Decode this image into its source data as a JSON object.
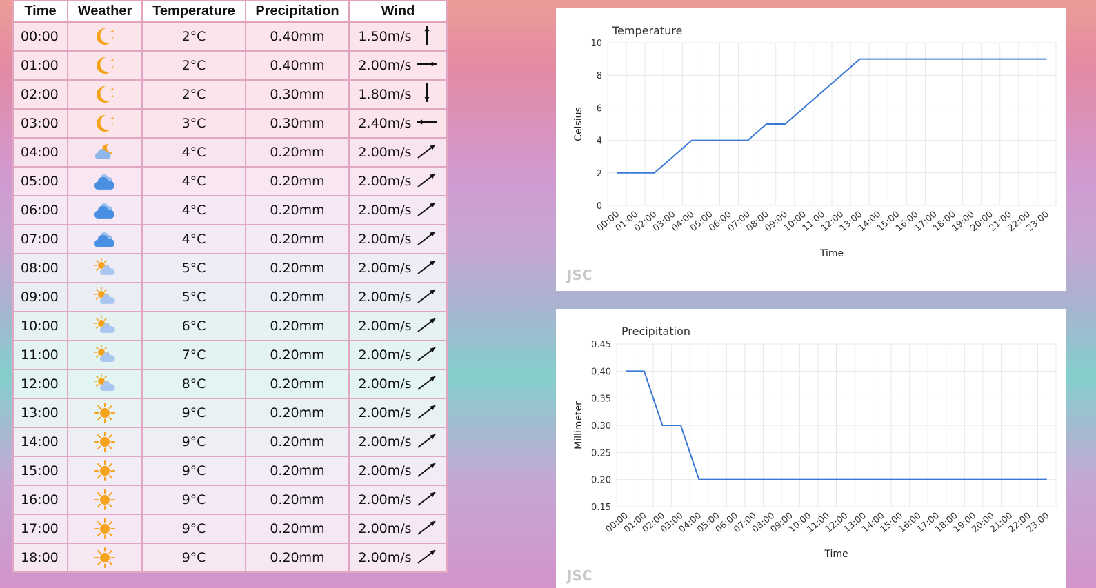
{
  "table": {
    "headers": [
      "Time",
      "Weather",
      "Temperature",
      "Precipitation",
      "Wind"
    ],
    "rows": [
      {
        "time": "00:00",
        "weather": "night-clear-icon",
        "temp": "2°C",
        "precip": "0.40mm",
        "wind": "1.50m/s",
        "dir": "north-arrow-icon"
      },
      {
        "time": "01:00",
        "weather": "night-clear-icon",
        "temp": "2°C",
        "precip": "0.40mm",
        "wind": "2.00m/s",
        "dir": "east-arrow-icon"
      },
      {
        "time": "02:00",
        "weather": "night-clear-icon",
        "temp": "2°C",
        "precip": "0.30mm",
        "wind": "1.80m/s",
        "dir": "south-arrow-icon"
      },
      {
        "time": "03:00",
        "weather": "night-clear-icon",
        "temp": "3°C",
        "precip": "0.30mm",
        "wind": "2.40m/s",
        "dir": "west-arrow-icon"
      },
      {
        "time": "04:00",
        "weather": "night-cloudy-icon",
        "temp": "4°C",
        "precip": "0.20mm",
        "wind": "2.00m/s",
        "dir": "northeast-arrow-icon"
      },
      {
        "time": "05:00",
        "weather": "cloudy-icon",
        "temp": "4°C",
        "precip": "0.20mm",
        "wind": "2.00m/s",
        "dir": "northeast-arrow-icon"
      },
      {
        "time": "06:00",
        "weather": "cloudy-icon",
        "temp": "4°C",
        "precip": "0.20mm",
        "wind": "2.00m/s",
        "dir": "northeast-arrow-icon"
      },
      {
        "time": "07:00",
        "weather": "cloudy-icon",
        "temp": "4°C",
        "precip": "0.20mm",
        "wind": "2.00m/s",
        "dir": "northeast-arrow-icon"
      },
      {
        "time": "08:00",
        "weather": "partly-sunny-icon",
        "temp": "5°C",
        "precip": "0.20mm",
        "wind": "2.00m/s",
        "dir": "northeast-arrow-icon"
      },
      {
        "time": "09:00",
        "weather": "partly-sunny-icon",
        "temp": "5°C",
        "precip": "0.20mm",
        "wind": "2.00m/s",
        "dir": "northeast-arrow-icon"
      },
      {
        "time": "10:00",
        "weather": "partly-sunny-icon",
        "temp": "6°C",
        "precip": "0.20mm",
        "wind": "2.00m/s",
        "dir": "northeast-arrow-icon"
      },
      {
        "time": "11:00",
        "weather": "partly-sunny-icon",
        "temp": "7°C",
        "precip": "0.20mm",
        "wind": "2.00m/s",
        "dir": "northeast-arrow-icon"
      },
      {
        "time": "12:00",
        "weather": "partly-sunny-icon",
        "temp": "8°C",
        "precip": "0.20mm",
        "wind": "2.00m/s",
        "dir": "northeast-arrow-icon"
      },
      {
        "time": "13:00",
        "weather": "sunny-icon",
        "temp": "9°C",
        "precip": "0.20mm",
        "wind": "2.00m/s",
        "dir": "northeast-arrow-icon"
      },
      {
        "time": "14:00",
        "weather": "sunny-icon",
        "temp": "9°C",
        "precip": "0.20mm",
        "wind": "2.00m/s",
        "dir": "northeast-arrow-icon"
      },
      {
        "time": "15:00",
        "weather": "sunny-icon",
        "temp": "9°C",
        "precip": "0.20mm",
        "wind": "2.00m/s",
        "dir": "northeast-arrow-icon"
      },
      {
        "time": "16:00",
        "weather": "sunny-icon",
        "temp": "9°C",
        "precip": "0.20mm",
        "wind": "2.00m/s",
        "dir": "northeast-arrow-icon"
      },
      {
        "time": "17:00",
        "weather": "sunny-icon",
        "temp": "9°C",
        "precip": "0.20mm",
        "wind": "2.00m/s",
        "dir": "northeast-arrow-icon"
      },
      {
        "time": "18:00",
        "weather": "sunny-icon",
        "temp": "9°C",
        "precip": "0.20mm",
        "wind": "2.00m/s",
        "dir": "northeast-arrow-icon"
      }
    ]
  },
  "colors": {
    "series": "#3a78d6",
    "sun": "#f5a31a",
    "cloud": "#4a90e2",
    "row_border": "#e2a6c5"
  },
  "logo_text": "JSC",
  "chart_data": [
    {
      "type": "line",
      "title": "Temperature",
      "xlabel": "Time",
      "ylabel": "Celsius",
      "x": [
        "00:00",
        "01:00",
        "02:00",
        "03:00",
        "04:00",
        "05:00",
        "06:00",
        "07:00",
        "08:00",
        "09:00",
        "10:00",
        "11:00",
        "12:00",
        "13:00",
        "14:00",
        "15:00",
        "16:00",
        "17:00",
        "18:00",
        "19:00",
        "20:00",
        "21:00",
        "22:00",
        "23:00"
      ],
      "values": [
        2,
        2,
        2,
        3,
        4,
        4,
        4,
        4,
        5,
        5,
        6,
        7,
        8,
        9,
        9,
        9,
        9,
        9,
        9,
        9,
        9,
        9,
        9,
        9
      ],
      "ylim": [
        0,
        10
      ],
      "yticks": [
        "0",
        "2",
        "4",
        "6",
        "8",
        "10"
      ],
      "grid": true
    },
    {
      "type": "line",
      "title": "Precipitation",
      "xlabel": "Time",
      "ylabel": "Millimeter",
      "x": [
        "00:00",
        "01:00",
        "02:00",
        "03:00",
        "04:00",
        "05:00",
        "06:00",
        "07:00",
        "08:00",
        "09:00",
        "10:00",
        "11:00",
        "12:00",
        "13:00",
        "14:00",
        "15:00",
        "16:00",
        "17:00",
        "18:00",
        "19:00",
        "20:00",
        "21:00",
        "22:00",
        "23:00"
      ],
      "values": [
        0.4,
        0.4,
        0.3,
        0.3,
        0.2,
        0.2,
        0.2,
        0.2,
        0.2,
        0.2,
        0.2,
        0.2,
        0.2,
        0.2,
        0.2,
        0.2,
        0.2,
        0.2,
        0.2,
        0.2,
        0.2,
        0.2,
        0.2,
        0.2
      ],
      "ylim": [
        0.15,
        0.45
      ],
      "yticks": [
        "0.15",
        "0.20",
        "0.25",
        "0.30",
        "0.35",
        "0.40",
        "0.45"
      ],
      "grid": true
    }
  ]
}
